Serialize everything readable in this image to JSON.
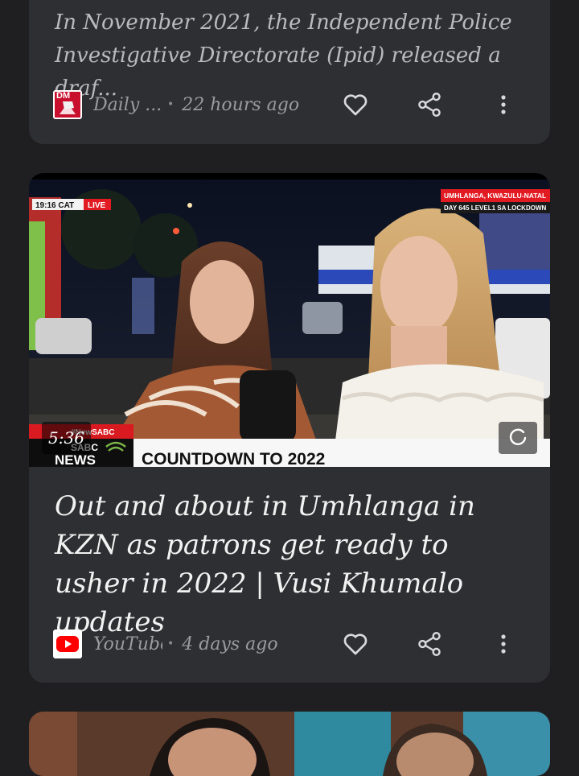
{
  "card1": {
    "snippet": "In November 2021, the Independent Police Investigative Directorate (Ipid) released a draf...",
    "source_name": "Daily ...",
    "source_logo_text": "DM",
    "time": "22 hours ago"
  },
  "card2": {
    "headline": "Out and about in Umhlanga in KZN as patrons get ready to usher in 2022 | Vusi Khumalo updates",
    "duration": "5:36",
    "source_name": "YouTube",
    "time": "4 days ago",
    "thumbnail": {
      "clock_text": "19:16 CAT",
      "live_text": "LIVE",
      "location_text": "UMHLANGA, KWAZULU-NATAL",
      "lockdown_text": "DAY 645 LEVEL1 SA LOCKDOWN",
      "channel_top": "#NewSABC",
      "channel_logo_1": "SABC",
      "channel_logo_2": "NEWS",
      "banner": "COUNTDOWN TO 2022"
    }
  },
  "separator": "•",
  "icons": [
    "heart-icon",
    "share-icon",
    "more-vert-icon",
    "youtube-icon",
    "refresh-icon"
  ],
  "colors": {
    "background": "#1f1f21",
    "card": "#2e2f32",
    "youtube_red": "#ff0000",
    "live_red": "#e21b23"
  }
}
